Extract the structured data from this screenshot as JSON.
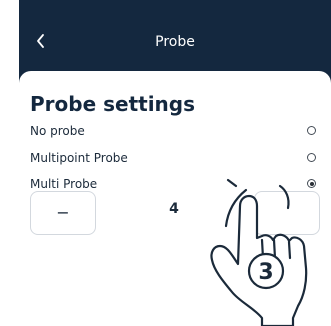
{
  "header": {
    "title": "Probe",
    "back_icon": "chevron-left-icon"
  },
  "settings": {
    "title": "Probe settings",
    "options": [
      {
        "label": "No probe",
        "selected": false
      },
      {
        "label": "Multipoint Probe",
        "selected": false
      },
      {
        "label": "Multi Probe",
        "selected": true
      }
    ]
  },
  "stepper": {
    "minus_label": "−",
    "value": "4"
  },
  "annotation": {
    "step_number": "3",
    "icon": "pointing-hand-icon"
  },
  "colors": {
    "header_bg": "#14283f",
    "sheet_bg": "#ffffff",
    "text": "#1b2a3a"
  }
}
